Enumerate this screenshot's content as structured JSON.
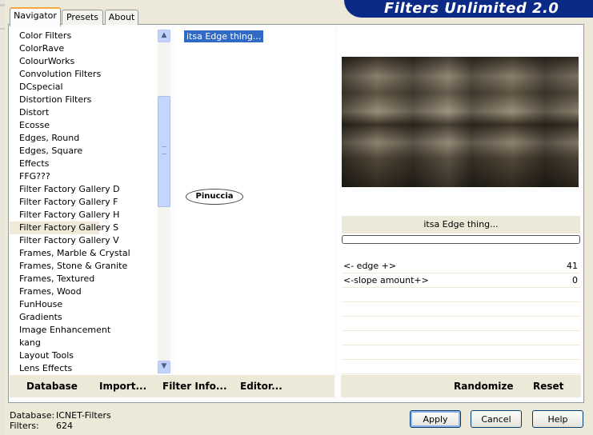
{
  "window": {
    "banner_title": "Filters Unlimited 2.0"
  },
  "tabs": [
    {
      "label": "Navigator",
      "active": true
    },
    {
      "label": "Presets",
      "active": false
    },
    {
      "label": "About",
      "active": false
    }
  ],
  "categories": [
    "Color Filters",
    "ColorRave",
    "ColourWorks",
    "Convolution Filters",
    "DCspecial",
    "Distortion Filters",
    "Distort",
    "Ecosse",
    "Edges, Round",
    "Edges, Square",
    "Effects",
    "FFG???",
    "Filter Factory Gallery D",
    "Filter Factory Gallery F",
    "Filter Factory Gallery H",
    "Filter Factory Gallery S",
    "Filter Factory Gallery V",
    "Frames, Marble & Crystal",
    "Frames, Stone & Granite",
    "Frames, Textured",
    "Frames, Wood",
    "FunHouse",
    "Gradients",
    "Image Enhancement",
    "kang",
    "Layout Tools",
    "Lens Effects"
  ],
  "selected_category": "Filter Factory Gallery S",
  "filters": [
    {
      "label": "itsa Edge thing..."
    }
  ],
  "watermark_text": "Pinuccia",
  "preview": {
    "filter_name": "itsa Edge thing...",
    "params": [
      {
        "label": "<- edge +>",
        "value": "41"
      },
      {
        "label": "<-slope amount+>",
        "value": "0"
      }
    ]
  },
  "bottom_links": {
    "database": "Database",
    "import": "Import...",
    "filter_info": "Filter Info...",
    "editor": "Editor...",
    "randomize": "Randomize",
    "reset": "Reset"
  },
  "status": {
    "database_label": "Database:",
    "database_value": "ICNET-Filters",
    "filters_label": "Filters:",
    "filters_value": "624"
  },
  "buttons": {
    "apply": "Apply",
    "cancel": "Cancel",
    "help": "Help"
  },
  "icons": {
    "scroll_up": "chevron-up-icon",
    "scroll_down": "chevron-down-icon"
  },
  "colors": {
    "banner": "#0b2a86",
    "selection": "#316ac5",
    "tab_highlight": "#f4a73b"
  }
}
